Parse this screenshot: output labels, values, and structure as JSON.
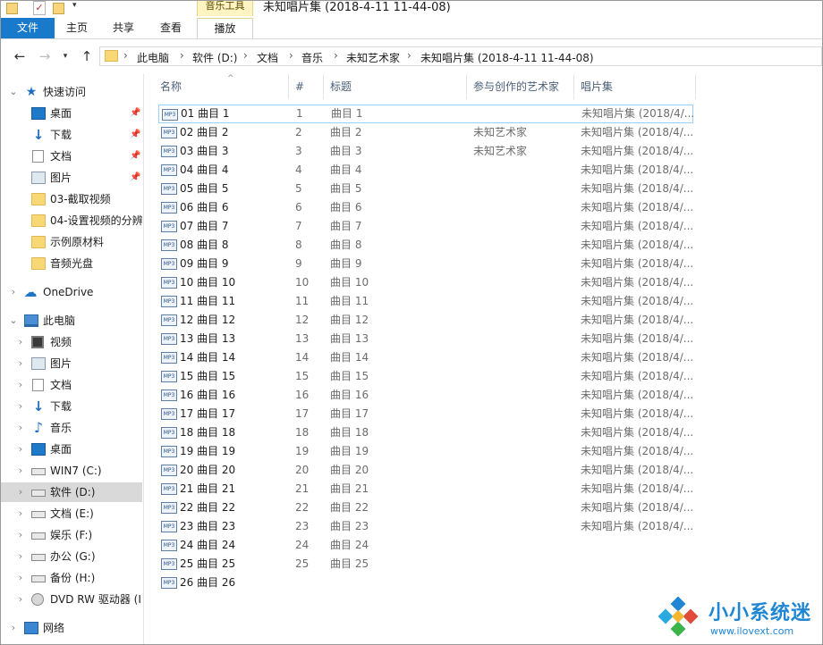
{
  "window": {
    "title": "未知唱片集 (2018-4-11 11-44-08)",
    "context_tab_group": "音乐工具"
  },
  "ribbon": {
    "tabs": [
      "文件",
      "主页",
      "共享",
      "查看",
      "播放"
    ]
  },
  "address": {
    "breadcrumbs": [
      "此电脑",
      "软件 (D:)",
      "文档",
      "音乐",
      "未知艺术家",
      "未知唱片集 (2018-4-11 11-44-08)"
    ]
  },
  "nav": {
    "items": [
      {
        "label": "快速访问",
        "icon": "star-icon"
      },
      {
        "label": "桌面",
        "icon": "desktop-icon"
      },
      {
        "label": "下载",
        "icon": "download-icon"
      },
      {
        "label": "文档",
        "icon": "document-icon"
      },
      {
        "label": "图片",
        "icon": "pictures-icon"
      },
      {
        "label": "03-截取视频",
        "icon": "folder-icon"
      },
      {
        "label": "04-设置视频的分辨",
        "icon": "folder-icon"
      },
      {
        "label": "示例原材料",
        "icon": "folder-icon"
      },
      {
        "label": "音频光盘",
        "icon": "folder-icon"
      },
      {
        "label": "OneDrive",
        "icon": "cloud-icon"
      },
      {
        "label": "此电脑",
        "icon": "computer-icon"
      },
      {
        "label": "视频",
        "icon": "video-icon"
      },
      {
        "label": "图片",
        "icon": "pictures-icon"
      },
      {
        "label": "文档",
        "icon": "document-icon"
      },
      {
        "label": "下载",
        "icon": "download-icon"
      },
      {
        "label": "音乐",
        "icon": "music-icon"
      },
      {
        "label": "桌面",
        "icon": "desktop-icon"
      },
      {
        "label": "WIN7 (C:)",
        "icon": "drive-icon"
      },
      {
        "label": "软件 (D:)",
        "icon": "drive-icon"
      },
      {
        "label": "文档 (E:)",
        "icon": "drive-icon"
      },
      {
        "label": "娱乐 (F:)",
        "icon": "drive-icon"
      },
      {
        "label": "办公 (G:)",
        "icon": "drive-icon"
      },
      {
        "label": "备份 (H:)",
        "icon": "drive-icon"
      },
      {
        "label": "DVD RW 驱动器 (I",
        "icon": "dvd-icon"
      },
      {
        "label": "网络",
        "icon": "network-icon"
      }
    ]
  },
  "columns": {
    "name": "名称",
    "number": "#",
    "title": "标题",
    "artist": "参与创作的艺术家",
    "album": "唱片集"
  },
  "files": [
    {
      "name": "01 曲目 1",
      "number": "1",
      "title": "曲目 1",
      "artist": "",
      "album": "未知唱片集 (2018/4/..."
    },
    {
      "name": "02 曲目 2",
      "number": "2",
      "title": "曲目 2",
      "artist": "未知艺术家",
      "album": "未知唱片集 (2018/4/..."
    },
    {
      "name": "03 曲目 3",
      "number": "3",
      "title": "曲目 3",
      "artist": "未知艺术家",
      "album": "未知唱片集 (2018/4/..."
    },
    {
      "name": "04 曲目 4",
      "number": "4",
      "title": "曲目 4",
      "artist": "",
      "album": "未知唱片集 (2018/4/..."
    },
    {
      "name": "05 曲目 5",
      "number": "5",
      "title": "曲目 5",
      "artist": "",
      "album": "未知唱片集 (2018/4/..."
    },
    {
      "name": "06 曲目 6",
      "number": "6",
      "title": "曲目 6",
      "artist": "",
      "album": "未知唱片集 (2018/4/..."
    },
    {
      "name": "07 曲目 7",
      "number": "7",
      "title": "曲目 7",
      "artist": "",
      "album": "未知唱片集 (2018/4/..."
    },
    {
      "name": "08 曲目 8",
      "number": "8",
      "title": "曲目 8",
      "artist": "",
      "album": "未知唱片集 (2018/4/..."
    },
    {
      "name": "09 曲目 9",
      "number": "9",
      "title": "曲目 9",
      "artist": "",
      "album": "未知唱片集 (2018/4/..."
    },
    {
      "name": "10 曲目 10",
      "number": "10",
      "title": "曲目 10",
      "artist": "",
      "album": "未知唱片集 (2018/4/..."
    },
    {
      "name": "11 曲目 11",
      "number": "11",
      "title": "曲目 11",
      "artist": "",
      "album": "未知唱片集 (2018/4/..."
    },
    {
      "name": "12 曲目 12",
      "number": "12",
      "title": "曲目 12",
      "artist": "",
      "album": "未知唱片集 (2018/4/..."
    },
    {
      "name": "13 曲目 13",
      "number": "13",
      "title": "曲目 13",
      "artist": "",
      "album": "未知唱片集 (2018/4/..."
    },
    {
      "name": "14 曲目 14",
      "number": "14",
      "title": "曲目 14",
      "artist": "",
      "album": "未知唱片集 (2018/4/..."
    },
    {
      "name": "15 曲目 15",
      "number": "15",
      "title": "曲目 15",
      "artist": "",
      "album": "未知唱片集 (2018/4/..."
    },
    {
      "name": "16 曲目 16",
      "number": "16",
      "title": "曲目 16",
      "artist": "",
      "album": "未知唱片集 (2018/4/..."
    },
    {
      "name": "17 曲目 17",
      "number": "17",
      "title": "曲目 17",
      "artist": "",
      "album": "未知唱片集 (2018/4/..."
    },
    {
      "name": "18 曲目 18",
      "number": "18",
      "title": "曲目 18",
      "artist": "",
      "album": "未知唱片集 (2018/4/..."
    },
    {
      "name": "19 曲目 19",
      "number": "19",
      "title": "曲目 19",
      "artist": "",
      "album": "未知唱片集 (2018/4/..."
    },
    {
      "name": "20 曲目 20",
      "number": "20",
      "title": "曲目 20",
      "artist": "",
      "album": "未知唱片集 (2018/4/..."
    },
    {
      "name": "21 曲目 21",
      "number": "21",
      "title": "曲目 21",
      "artist": "",
      "album": "未知唱片集 (2018/4/..."
    },
    {
      "name": "22 曲目 22",
      "number": "22",
      "title": "曲目 22",
      "artist": "",
      "album": "未知唱片集 (2018/4/..."
    },
    {
      "name": "23 曲目 23",
      "number": "23",
      "title": "曲目 23",
      "artist": "",
      "album": "未知唱片集 (2018/4/..."
    },
    {
      "name": "24 曲目 24",
      "number": "24",
      "title": "曲目 24",
      "artist": "",
      "album": ""
    },
    {
      "name": "25 曲目 25",
      "number": "25",
      "title": "曲目 25",
      "artist": "",
      "album": ""
    },
    {
      "name": "26 曲目 26",
      "number": "",
      "title": "",
      "artist": "",
      "album": ""
    }
  ],
  "watermark": {
    "text": "小小系统迷",
    "url": "www.ilovext.com"
  },
  "colors": {
    "file_tab": "#1979ca",
    "selection": "#d9d9d9",
    "focus_border": "#99d1ff",
    "context_tab": "#fff4c2",
    "watermark": "#1f86d4"
  }
}
